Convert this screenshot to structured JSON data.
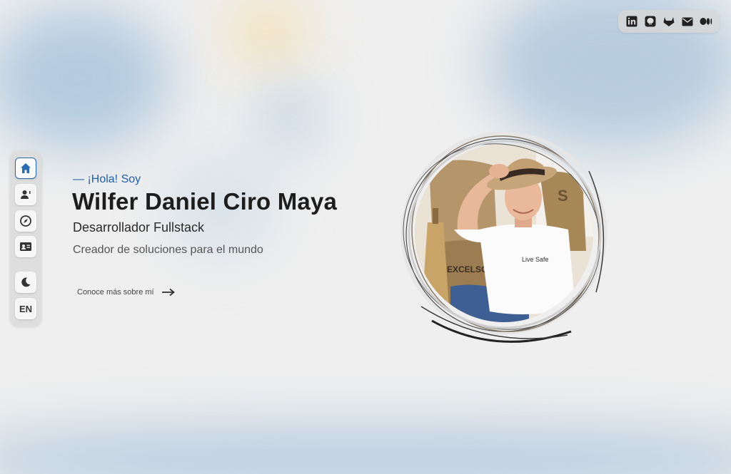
{
  "social": {
    "items": [
      {
        "icon": "linkedin-icon",
        "label": "in"
      },
      {
        "icon": "github-icon"
      },
      {
        "icon": "gitlab-icon"
      },
      {
        "icon": "mail-icon"
      },
      {
        "icon": "medium-icon"
      }
    ]
  },
  "sidebar": {
    "items": [
      {
        "icon": "home-icon",
        "active": true
      },
      {
        "icon": "user-icon"
      },
      {
        "icon": "compass-icon"
      },
      {
        "icon": "contact-card-icon"
      },
      {
        "icon": "moon-icon"
      }
    ],
    "lang_label": "EN"
  },
  "hero": {
    "greeting": "— ¡Hola! Soy",
    "name": "Wilfer Daniel Ciro Maya",
    "role": "Desarrollador Fullstack",
    "tagline": "Creador de soluciones para el mundo",
    "more_label": "Conoce más sobre mí"
  },
  "photo": {
    "alt": "profile-photo",
    "bag_text": "EXCELSO",
    "shirt_text": "Live Safe"
  },
  "colors": {
    "accent": "#1f5fa8",
    "background": "#efefef",
    "text": "#1d1d1d"
  }
}
